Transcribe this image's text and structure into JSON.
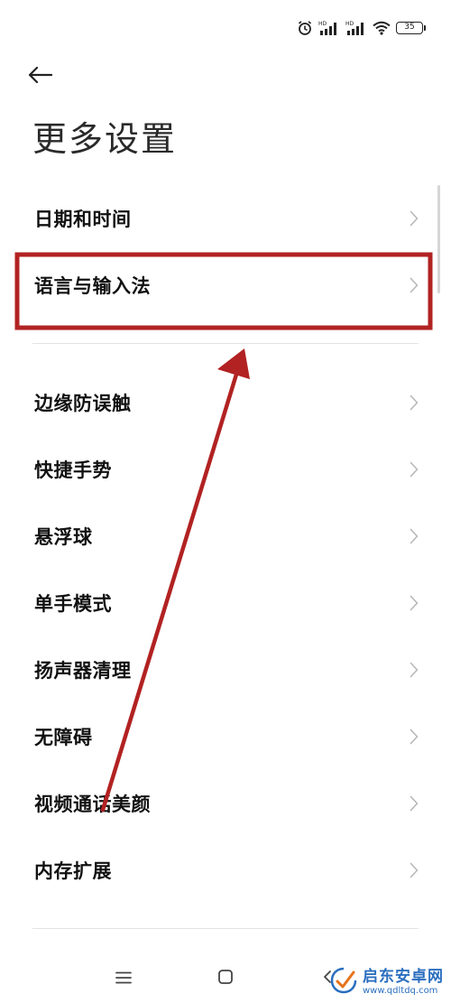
{
  "status_bar": {
    "battery_level": "35",
    "icons": [
      "alarm-icon",
      "hd-signal-icon",
      "hd-signal-icon",
      "wifi-icon",
      "battery-icon"
    ]
  },
  "header": {
    "back_icon": "arrow-left-icon",
    "title": "更多设置"
  },
  "settings": {
    "items": [
      {
        "label": "日期和时间"
      },
      {
        "label": "语言与输入法"
      },
      {
        "label": "边缘防误触"
      },
      {
        "label": "快捷手势"
      },
      {
        "label": "悬浮球"
      },
      {
        "label": "单手模式"
      },
      {
        "label": "扬声器清理"
      },
      {
        "label": "无障碍"
      },
      {
        "label": "视频通话美颜"
      },
      {
        "label": "内存扩展"
      }
    ]
  },
  "nav_bar": {
    "icons": [
      "menu-icon",
      "home-icon",
      "back-icon"
    ]
  },
  "annotation": {
    "highlight_color": "#b22222",
    "arrow_color": "#b22222"
  },
  "watermark": {
    "title": "启东安卓网",
    "url": "www.qdltdq.com",
    "color": "#2a6ebf"
  }
}
